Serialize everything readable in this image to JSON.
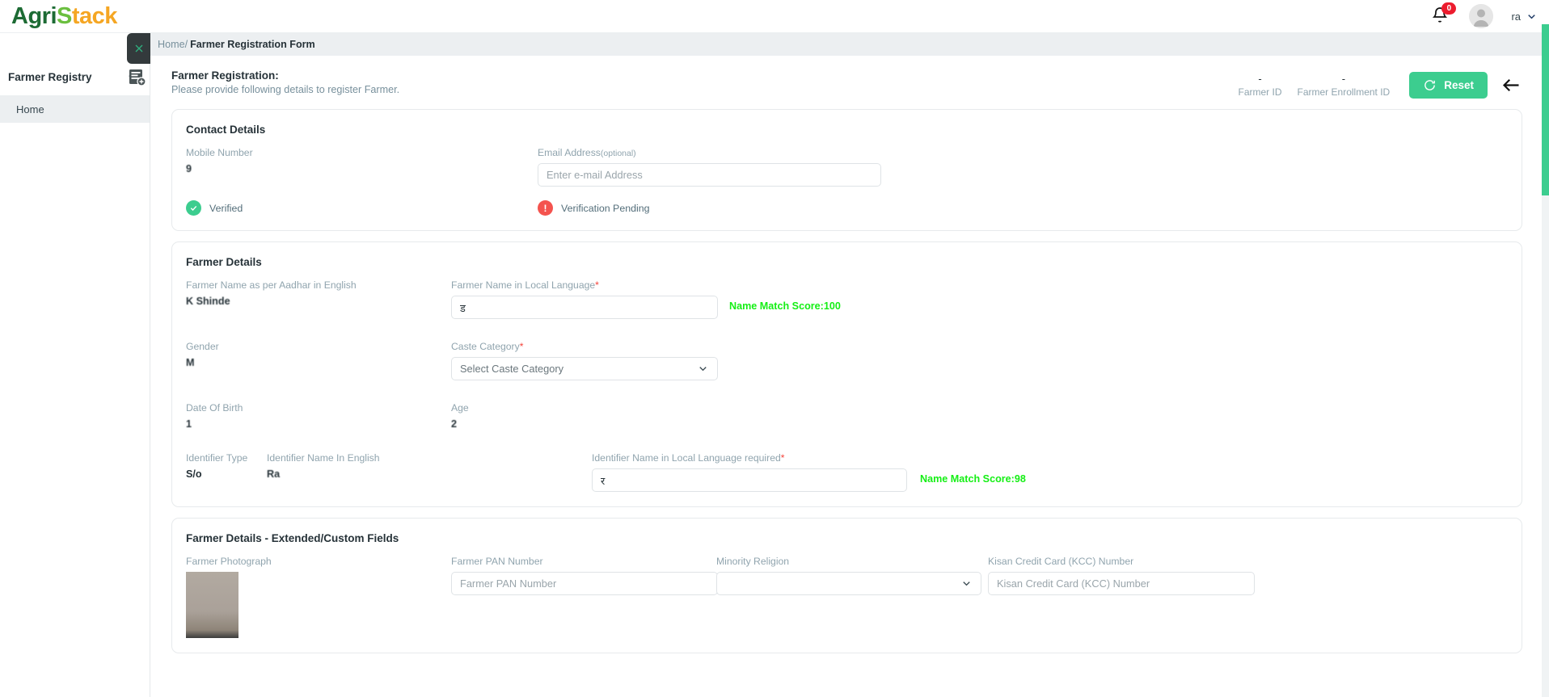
{
  "brand": {
    "part1": "Agri",
    "part2": "S",
    "part3": "tack"
  },
  "topbar": {
    "notification_count": "0",
    "bell_icon": "bell-icon",
    "avatar_icon": "user-avatar-icon",
    "user_name": "ra",
    "user_caret_icon": "chevron-down-icon"
  },
  "sidebar": {
    "registry_label": "Farmer Registry",
    "registry_caret_icon": "chevron-down-icon",
    "close_tab_icon": "close-icon",
    "form_icon": "add-form-icon",
    "items": [
      {
        "label": "Home",
        "name": "sidebar-item-home"
      }
    ]
  },
  "breadcrumb": {
    "home": "Home/",
    "current": "Farmer Registration Form"
  },
  "page_head": {
    "title": "Farmer Registration:",
    "subtitle": "Please provide following details to register Farmer.",
    "farmer_id_value": "-",
    "farmer_id_label": "Farmer ID",
    "enrollment_id_value": "-",
    "enrollment_id_label": "Farmer Enrollment ID",
    "reset_label": "Reset",
    "reset_icon": "refresh-icon",
    "back_icon": "arrow-left-icon"
  },
  "contact": {
    "title": "Contact Details",
    "mobile_label": "Mobile Number",
    "mobile_value": "9",
    "email_label": "Email Address",
    "email_optional": "(optional)",
    "email_placeholder": "Enter e-mail Address",
    "email_value": "",
    "mobile_status": "Verified",
    "mobile_status_icon": "check-circle-icon",
    "email_status": "Verification Pending",
    "email_status_icon": "alert-circle-icon"
  },
  "farmer": {
    "title": "Farmer Details",
    "name_en_label": "Farmer Name as per Aadhar in English",
    "name_en_value": "K        Shinde",
    "name_local_label": "Farmer Name in Local Language",
    "name_local_value": "ड",
    "name_local_score": "Name Match Score:100",
    "gender_label": "Gender",
    "gender_value": "M",
    "caste_label": "Caste Category",
    "caste_placeholder": "Select Caste Category",
    "caste_caret_icon": "chevron-down-icon",
    "dob_label": "Date Of Birth",
    "dob_value": "1",
    "age_label": "Age",
    "age_value": "2",
    "identifier_type_label": "Identifier Type",
    "identifier_type_value": "S/o",
    "identifier_name_en_label": "Identifier Name In English",
    "identifier_name_en_value": "Ra",
    "identifier_name_local_label": "Identifier Name in Local Language required",
    "identifier_name_local_value": "र",
    "identifier_score": "Name Match Score:98"
  },
  "extended": {
    "title": "Farmer Details - Extended/Custom Fields",
    "photo_label": "Farmer Photograph",
    "photo_icon": "farmer-photograph-image",
    "pan_label": "Farmer PAN Number",
    "pan_placeholder": "Farmer PAN Number",
    "pan_value": "",
    "religion_label": "Minority Religion",
    "religion_value": "",
    "religion_caret_icon": "chevron-down-icon",
    "kcc_label": "Kisan Credit Card (KCC) Number",
    "kcc_placeholder": "Kisan Credit Card (KCC) Number",
    "kcc_value": ""
  },
  "colors": {
    "accent_green": "#3ccd8f",
    "score_green": "#15ef15",
    "alert_red": "#f4534e",
    "badge_red": "#ec1c2e",
    "brand_green": "#1d6b34",
    "brand_orange": "#f5a623"
  }
}
